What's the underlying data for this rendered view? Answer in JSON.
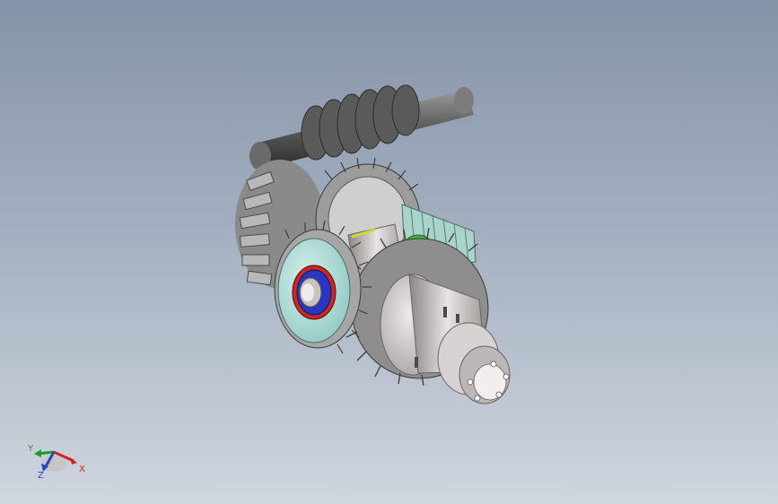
{
  "viewport": {
    "background_top": "#8593a8",
    "background_bottom": "#cfd6de"
  },
  "model": {
    "description_icon": "gearbox-assembly-icon",
    "parts": [
      "worm-shaft",
      "worm-gear",
      "bevel-ring-gear",
      "bevel-pinion",
      "spur-gear",
      "bearing",
      "output-shaft-housing"
    ]
  },
  "triad": {
    "x_label": "X",
    "y_label": "Y",
    "z_label": "Z",
    "x_color": "#d42020",
    "y_color": "#1c9e2a",
    "z_color": "#2a45c8"
  }
}
